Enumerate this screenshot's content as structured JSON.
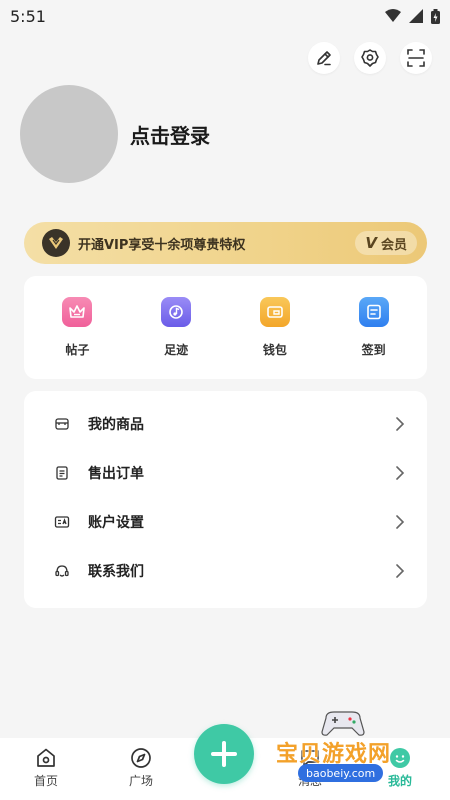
{
  "status_bar": {
    "time": "5:51"
  },
  "profile": {
    "login_label": "点击登录"
  },
  "vip_banner": {
    "text": "开通VIP享受十余项尊贵特权",
    "badge_label": "会员",
    "badge_mark": "V"
  },
  "quick_actions": [
    {
      "label": "帖子",
      "icon": "crown-icon",
      "color": "#f36d9a"
    },
    {
      "label": "足迹",
      "icon": "note-icon",
      "color": "#7a6ff0"
    },
    {
      "label": "钱包",
      "icon": "wallet-icon",
      "color": "#f6b23a"
    },
    {
      "label": "签到",
      "icon": "checkin-icon",
      "color": "#3b8ff2"
    }
  ],
  "menu": [
    {
      "label": "我的商品",
      "icon": "shop-icon"
    },
    {
      "label": "售出订单",
      "icon": "order-icon"
    },
    {
      "label": "账户设置",
      "icon": "account-icon"
    },
    {
      "label": "联系我们",
      "icon": "contact-icon"
    }
  ],
  "bottom_nav": [
    {
      "label": "首页",
      "icon": "home-icon"
    },
    {
      "label": "广场",
      "icon": "compass-icon"
    },
    {
      "label": "消息",
      "icon": "message-icon"
    },
    {
      "label": "我的",
      "icon": "profile-icon"
    }
  ],
  "watermark": {
    "text": "宝贝游戏网",
    "url": "baobeiy.com"
  },
  "colors": {
    "accent": "#3fc9a5",
    "vip_gold": "#f0d38a",
    "background": "#f5f5f5"
  }
}
